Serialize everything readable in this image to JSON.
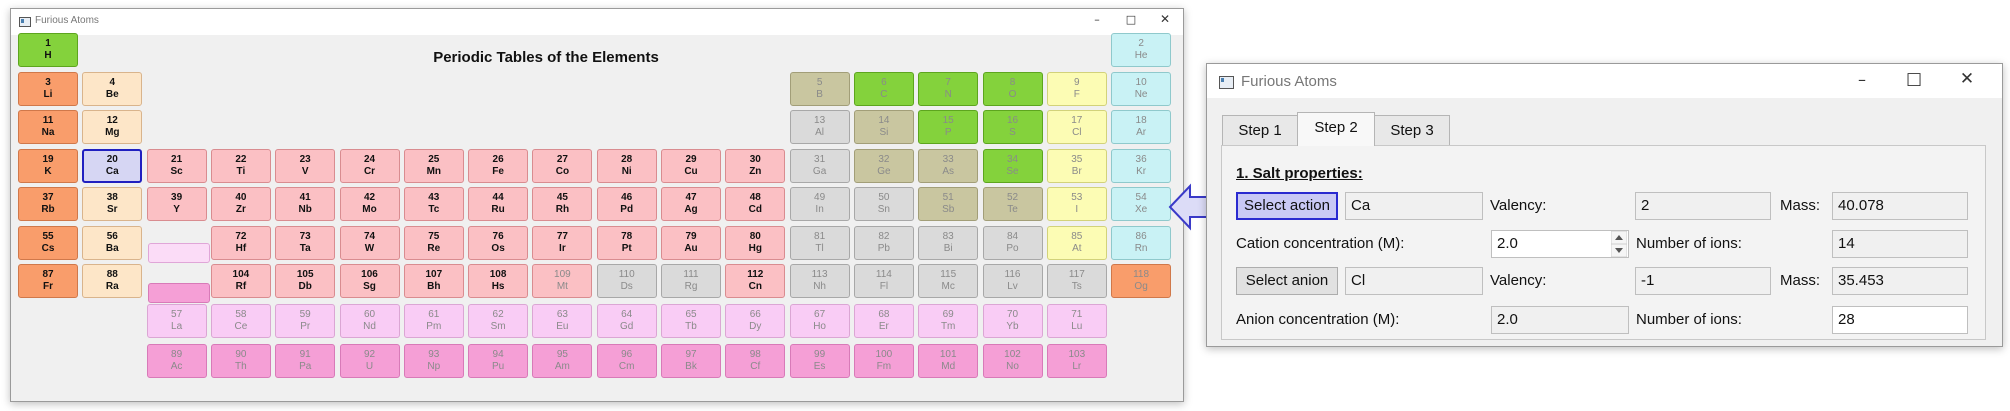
{
  "main_window": {
    "title": "Furious Atoms",
    "heading": "Periodic Tables of the Elements"
  },
  "colors": {
    "alkali": "#f99d6b",
    "alkaline": "#fde6c8",
    "transition": "#fbc0c4",
    "post_transition": "#dadada",
    "metalloid": "#c9c6a0",
    "nonmetal": "#84d23c",
    "halogen": "#fcfcb4",
    "noble": "#c9f2f5",
    "lanthanide": "#f9ccf5",
    "actinide": "#f59fd6",
    "hydrogen": "#84d23c"
  },
  "elements": [
    {
      "n": "1",
      "s": "H",
      "r": 1,
      "c": 1,
      "cat": "hydrogen",
      "st": "bold"
    },
    {
      "n": "2",
      "s": "He",
      "r": 1,
      "c": 18,
      "cat": "noble",
      "st": "dim"
    },
    {
      "n": "3",
      "s": "Li",
      "r": 2,
      "c": 1,
      "cat": "alkali",
      "st": "bold"
    },
    {
      "n": "4",
      "s": "Be",
      "r": 2,
      "c": 2,
      "cat": "alkaline",
      "st": "bold"
    },
    {
      "n": "5",
      "s": "B",
      "r": 2,
      "c": 13,
      "cat": "metalloid",
      "st": "dim"
    },
    {
      "n": "6",
      "s": "C",
      "r": 2,
      "c": 14,
      "cat": "nonmetal",
      "st": "dim"
    },
    {
      "n": "7",
      "s": "N",
      "r": 2,
      "c": 15,
      "cat": "nonmetal",
      "st": "dim"
    },
    {
      "n": "8",
      "s": "O",
      "r": 2,
      "c": 16,
      "cat": "nonmetal",
      "st": "dim"
    },
    {
      "n": "9",
      "s": "F",
      "r": 2,
      "c": 17,
      "cat": "halogen",
      "st": "dim"
    },
    {
      "n": "10",
      "s": "Ne",
      "r": 2,
      "c": 18,
      "cat": "noble",
      "st": "dim"
    },
    {
      "n": "11",
      "s": "Na",
      "r": 3,
      "c": 1,
      "cat": "alkali",
      "st": "bold"
    },
    {
      "n": "12",
      "s": "Mg",
      "r": 3,
      "c": 2,
      "cat": "alkaline",
      "st": "bold"
    },
    {
      "n": "13",
      "s": "Al",
      "r": 3,
      "c": 13,
      "cat": "post_transition",
      "st": "dim"
    },
    {
      "n": "14",
      "s": "Si",
      "r": 3,
      "c": 14,
      "cat": "metalloid",
      "st": "dim"
    },
    {
      "n": "15",
      "s": "P",
      "r": 3,
      "c": 15,
      "cat": "nonmetal",
      "st": "dim"
    },
    {
      "n": "16",
      "s": "S",
      "r": 3,
      "c": 16,
      "cat": "nonmetal",
      "st": "dim"
    },
    {
      "n": "17",
      "s": "Cl",
      "r": 3,
      "c": 17,
      "cat": "halogen",
      "st": "dim"
    },
    {
      "n": "18",
      "s": "Ar",
      "r": 3,
      "c": 18,
      "cat": "noble",
      "st": "dim"
    },
    {
      "n": "19",
      "s": "K",
      "r": 4,
      "c": 1,
      "cat": "alkali",
      "st": "bold"
    },
    {
      "n": "20",
      "s": "Ca",
      "r": 4,
      "c": 2,
      "cat": "selected",
      "st": "bold"
    },
    {
      "n": "21",
      "s": "Sc",
      "r": 4,
      "c": 3,
      "cat": "transition",
      "st": "bold"
    },
    {
      "n": "22",
      "s": "Ti",
      "r": 4,
      "c": 4,
      "cat": "transition",
      "st": "bold"
    },
    {
      "n": "23",
      "s": "V",
      "r": 4,
      "c": 5,
      "cat": "transition",
      "st": "bold"
    },
    {
      "n": "24",
      "s": "Cr",
      "r": 4,
      "c": 6,
      "cat": "transition",
      "st": "bold"
    },
    {
      "n": "25",
      "s": "Mn",
      "r": 4,
      "c": 7,
      "cat": "transition",
      "st": "bold"
    },
    {
      "n": "26",
      "s": "Fe",
      "r": 4,
      "c": 8,
      "cat": "transition",
      "st": "bold"
    },
    {
      "n": "27",
      "s": "Co",
      "r": 4,
      "c": 9,
      "cat": "transition",
      "st": "bold"
    },
    {
      "n": "28",
      "s": "Ni",
      "r": 4,
      "c": 10,
      "cat": "transition",
      "st": "bold"
    },
    {
      "n": "29",
      "s": "Cu",
      "r": 4,
      "c": 11,
      "cat": "transition",
      "st": "bold"
    },
    {
      "n": "30",
      "s": "Zn",
      "r": 4,
      "c": 12,
      "cat": "transition",
      "st": "bold"
    },
    {
      "n": "31",
      "s": "Ga",
      "r": 4,
      "c": 13,
      "cat": "post_transition",
      "st": "dim"
    },
    {
      "n": "32",
      "s": "Ge",
      "r": 4,
      "c": 14,
      "cat": "metalloid",
      "st": "dim"
    },
    {
      "n": "33",
      "s": "As",
      "r": 4,
      "c": 15,
      "cat": "metalloid",
      "st": "dim"
    },
    {
      "n": "34",
      "s": "Se",
      "r": 4,
      "c": 16,
      "cat": "nonmetal",
      "st": "dim"
    },
    {
      "n": "35",
      "s": "Br",
      "r": 4,
      "c": 17,
      "cat": "halogen",
      "st": "dim"
    },
    {
      "n": "36",
      "s": "Kr",
      "r": 4,
      "c": 18,
      "cat": "noble",
      "st": "dim"
    },
    {
      "n": "37",
      "s": "Rb",
      "r": 5,
      "c": 1,
      "cat": "alkali",
      "st": "bold"
    },
    {
      "n": "38",
      "s": "Sr",
      "r": 5,
      "c": 2,
      "cat": "alkaline",
      "st": "bold"
    },
    {
      "n": "39",
      "s": "Y",
      "r": 5,
      "c": 3,
      "cat": "transition",
      "st": "bold"
    },
    {
      "n": "40",
      "s": "Zr",
      "r": 5,
      "c": 4,
      "cat": "transition",
      "st": "bold"
    },
    {
      "n": "41",
      "s": "Nb",
      "r": 5,
      "c": 5,
      "cat": "transition",
      "st": "bold"
    },
    {
      "n": "42",
      "s": "Mo",
      "r": 5,
      "c": 6,
      "cat": "transition",
      "st": "bold"
    },
    {
      "n": "43",
      "s": "Tc",
      "r": 5,
      "c": 7,
      "cat": "transition",
      "st": "bold"
    },
    {
      "n": "44",
      "s": "Ru",
      "r": 5,
      "c": 8,
      "cat": "transition",
      "st": "bold"
    },
    {
      "n": "45",
      "s": "Rh",
      "r": 5,
      "c": 9,
      "cat": "transition",
      "st": "bold"
    },
    {
      "n": "46",
      "s": "Pd",
      "r": 5,
      "c": 10,
      "cat": "transition",
      "st": "bold"
    },
    {
      "n": "47",
      "s": "Ag",
      "r": 5,
      "c": 11,
      "cat": "transition",
      "st": "bold"
    },
    {
      "n": "48",
      "s": "Cd",
      "r": 5,
      "c": 12,
      "cat": "transition",
      "st": "bold"
    },
    {
      "n": "49",
      "s": "In",
      "r": 5,
      "c": 13,
      "cat": "post_transition",
      "st": "dim"
    },
    {
      "n": "50",
      "s": "Sn",
      "r": 5,
      "c": 14,
      "cat": "post_transition",
      "st": "dim"
    },
    {
      "n": "51",
      "s": "Sb",
      "r": 5,
      "c": 15,
      "cat": "metalloid",
      "st": "dim"
    },
    {
      "n": "52",
      "s": "Te",
      "r": 5,
      "c": 16,
      "cat": "metalloid",
      "st": "dim"
    },
    {
      "n": "53",
      "s": "I",
      "r": 5,
      "c": 17,
      "cat": "halogen",
      "st": "dim"
    },
    {
      "n": "54",
      "s": "Xe",
      "r": 5,
      "c": 18,
      "cat": "noble",
      "st": "dim"
    },
    {
      "n": "55",
      "s": "Cs",
      "r": 6,
      "c": 1,
      "cat": "alkali",
      "st": "bold"
    },
    {
      "n": "56",
      "s": "Ba",
      "r": 6,
      "c": 2,
      "cat": "alkaline",
      "st": "bold"
    },
    {
      "n": "72",
      "s": "Hf",
      "r": 6,
      "c": 4,
      "cat": "transition",
      "st": "bold"
    },
    {
      "n": "73",
      "s": "Ta",
      "r": 6,
      "c": 5,
      "cat": "transition",
      "st": "bold"
    },
    {
      "n": "74",
      "s": "W",
      "r": 6,
      "c": 6,
      "cat": "transition",
      "st": "bold"
    },
    {
      "n": "75",
      "s": "Re",
      "r": 6,
      "c": 7,
      "cat": "transition",
      "st": "bold"
    },
    {
      "n": "76",
      "s": "Os",
      "r": 6,
      "c": 8,
      "cat": "transition",
      "st": "bold"
    },
    {
      "n": "77",
      "s": "Ir",
      "r": 6,
      "c": 9,
      "cat": "transition",
      "st": "bold"
    },
    {
      "n": "78",
      "s": "Pt",
      "r": 6,
      "c": 10,
      "cat": "transition",
      "st": "bold"
    },
    {
      "n": "79",
      "s": "Au",
      "r": 6,
      "c": 11,
      "cat": "transition",
      "st": "bold"
    },
    {
      "n": "80",
      "s": "Hg",
      "r": 6,
      "c": 12,
      "cat": "transition",
      "st": "bold"
    },
    {
      "n": "81",
      "s": "Tl",
      "r": 6,
      "c": 13,
      "cat": "post_transition",
      "st": "dim"
    },
    {
      "n": "82",
      "s": "Pb",
      "r": 6,
      "c": 14,
      "cat": "post_transition",
      "st": "dim"
    },
    {
      "n": "83",
      "s": "Bi",
      "r": 6,
      "c": 15,
      "cat": "post_transition",
      "st": "dim"
    },
    {
      "n": "84",
      "s": "Po",
      "r": 6,
      "c": 16,
      "cat": "post_transition",
      "st": "dim"
    },
    {
      "n": "85",
      "s": "At",
      "r": 6,
      "c": 17,
      "cat": "halogen",
      "st": "dim"
    },
    {
      "n": "86",
      "s": "Rn",
      "r": 6,
      "c": 18,
      "cat": "noble",
      "st": "dim"
    },
    {
      "n": "87",
      "s": "Fr",
      "r": 7,
      "c": 1,
      "cat": "alkali",
      "st": "bold"
    },
    {
      "n": "88",
      "s": "Ra",
      "r": 7,
      "c": 2,
      "cat": "alkaline",
      "st": "bold"
    },
    {
      "n": "104",
      "s": "Rf",
      "r": 7,
      "c": 4,
      "cat": "transition",
      "st": "bold"
    },
    {
      "n": "105",
      "s": "Db",
      "r": 7,
      "c": 5,
      "cat": "transition",
      "st": "bold"
    },
    {
      "n": "106",
      "s": "Sg",
      "r": 7,
      "c": 6,
      "cat": "transition",
      "st": "bold"
    },
    {
      "n": "107",
      "s": "Bh",
      "r": 7,
      "c": 7,
      "cat": "transition",
      "st": "bold"
    },
    {
      "n": "108",
      "s": "Hs",
      "r": 7,
      "c": 8,
      "cat": "transition",
      "st": "bold"
    },
    {
      "n": "109",
      "s": "Mt",
      "r": 7,
      "c": 9,
      "cat": "transition",
      "st": "dim"
    },
    {
      "n": "110",
      "s": "Ds",
      "r": 7,
      "c": 10,
      "cat": "post_transition",
      "st": "dim"
    },
    {
      "n": "111",
      "s": "Rg",
      "r": 7,
      "c": 11,
      "cat": "post_transition",
      "st": "dim"
    },
    {
      "n": "112",
      "s": "Cn",
      "r": 7,
      "c": 12,
      "cat": "transition",
      "st": "bold"
    },
    {
      "n": "113",
      "s": "Nh",
      "r": 7,
      "c": 13,
      "cat": "post_transition",
      "st": "dim"
    },
    {
      "n": "114",
      "s": "Fl",
      "r": 7,
      "c": 14,
      "cat": "post_transition",
      "st": "dim"
    },
    {
      "n": "115",
      "s": "Mc",
      "r": 7,
      "c": 15,
      "cat": "post_transition",
      "st": "dim"
    },
    {
      "n": "116",
      "s": "Lv",
      "r": 7,
      "c": 16,
      "cat": "post_transition",
      "st": "dim"
    },
    {
      "n": "117",
      "s": "Ts",
      "r": 7,
      "c": 17,
      "cat": "post_transition",
      "st": "dim"
    },
    {
      "n": "118",
      "s": "Og",
      "r": 7,
      "c": 18,
      "cat": "alkali",
      "st": "dim"
    },
    {
      "n": "57",
      "s": "La",
      "r": 8,
      "c": 3,
      "cat": "lanthanide",
      "st": "dim"
    },
    {
      "n": "58",
      "s": "Ce",
      "r": 8,
      "c": 4,
      "cat": "lanthanide",
      "st": "dim"
    },
    {
      "n": "59",
      "s": "Pr",
      "r": 8,
      "c": 5,
      "cat": "lanthanide",
      "st": "dim"
    },
    {
      "n": "60",
      "s": "Nd",
      "r": 8,
      "c": 6,
      "cat": "lanthanide",
      "st": "dim"
    },
    {
      "n": "61",
      "s": "Pm",
      "r": 8,
      "c": 7,
      "cat": "lanthanide",
      "st": "dim"
    },
    {
      "n": "62",
      "s": "Sm",
      "r": 8,
      "c": 8,
      "cat": "lanthanide",
      "st": "dim"
    },
    {
      "n": "63",
      "s": "Eu",
      "r": 8,
      "c": 9,
      "cat": "lanthanide",
      "st": "dim"
    },
    {
      "n": "64",
      "s": "Gd",
      "r": 8,
      "c": 10,
      "cat": "lanthanide",
      "st": "dim"
    },
    {
      "n": "65",
      "s": "Tb",
      "r": 8,
      "c": 11,
      "cat": "lanthanide",
      "st": "dim"
    },
    {
      "n": "66",
      "s": "Dy",
      "r": 8,
      "c": 12,
      "cat": "lanthanide",
      "st": "dim"
    },
    {
      "n": "67",
      "s": "Ho",
      "r": 8,
      "c": 13,
      "cat": "lanthanide",
      "st": "dim"
    },
    {
      "n": "68",
      "s": "Er",
      "r": 8,
      "c": 14,
      "cat": "lanthanide",
      "st": "dim"
    },
    {
      "n": "69",
      "s": "Tm",
      "r": 8,
      "c": 15,
      "cat": "lanthanide",
      "st": "dim"
    },
    {
      "n": "70",
      "s": "Yb",
      "r": 8,
      "c": 16,
      "cat": "lanthanide",
      "st": "dim"
    },
    {
      "n": "71",
      "s": "Lu",
      "r": 8,
      "c": 17,
      "cat": "lanthanide",
      "st": "dim"
    },
    {
      "n": "89",
      "s": "Ac",
      "r": 9,
      "c": 3,
      "cat": "actinide",
      "st": "dim"
    },
    {
      "n": "90",
      "s": "Th",
      "r": 9,
      "c": 4,
      "cat": "actinide",
      "st": "dim"
    },
    {
      "n": "91",
      "s": "Pa",
      "r": 9,
      "c": 5,
      "cat": "actinide",
      "st": "dim"
    },
    {
      "n": "92",
      "s": "U",
      "r": 9,
      "c": 6,
      "cat": "actinide",
      "st": "dim"
    },
    {
      "n": "93",
      "s": "Np",
      "r": 9,
      "c": 7,
      "cat": "actinide",
      "st": "dim"
    },
    {
      "n": "94",
      "s": "Pu",
      "r": 9,
      "c": 8,
      "cat": "actinide",
      "st": "dim"
    },
    {
      "n": "95",
      "s": "Am",
      "r": 9,
      "c": 9,
      "cat": "actinide",
      "st": "dim"
    },
    {
      "n": "96",
      "s": "Cm",
      "r": 9,
      "c": 10,
      "cat": "actinide",
      "st": "dim"
    },
    {
      "n": "97",
      "s": "Bk",
      "r": 9,
      "c": 11,
      "cat": "actinide",
      "st": "dim"
    },
    {
      "n": "98",
      "s": "Cf",
      "r": 9,
      "c": 12,
      "cat": "actinide",
      "st": "dim"
    },
    {
      "n": "99",
      "s": "Es",
      "r": 9,
      "c": 13,
      "cat": "actinide",
      "st": "dim"
    },
    {
      "n": "100",
      "s": "Fm",
      "r": 9,
      "c": 14,
      "cat": "actinide",
      "st": "dim"
    },
    {
      "n": "101",
      "s": "Md",
      "r": 9,
      "c": 15,
      "cat": "actinide",
      "st": "dim"
    },
    {
      "n": "102",
      "s": "No",
      "r": 9,
      "c": 16,
      "cat": "actinide",
      "st": "dim"
    },
    {
      "n": "103",
      "s": "Lr",
      "r": 9,
      "c": 17,
      "cat": "actinide",
      "st": "dim"
    }
  ],
  "dialog": {
    "title": "Furious Atoms",
    "tabs": [
      "Step 1",
      "Step 2",
      "Step 3"
    ],
    "active_tab": "Step 2",
    "section_title": "1. Salt properties:",
    "select_action_label": "Select action",
    "cation_value": "Ca",
    "valency_label": "Valency:",
    "cation_valency": "2",
    "mass_label": "Mass:",
    "cation_mass": "40.078",
    "cation_conc_label": "Cation concentration (M):",
    "cation_conc_value": "2.0",
    "ions_label": "Number of ions:",
    "cation_ions": "14",
    "select_anion_label": "Select anion",
    "anion_value": "Cl",
    "anion_valency": "-1",
    "anion_mass": "35.453",
    "anion_conc_label": "Anion concentration (M):",
    "anion_conc_value": "2.0",
    "anion_ions": "28"
  }
}
